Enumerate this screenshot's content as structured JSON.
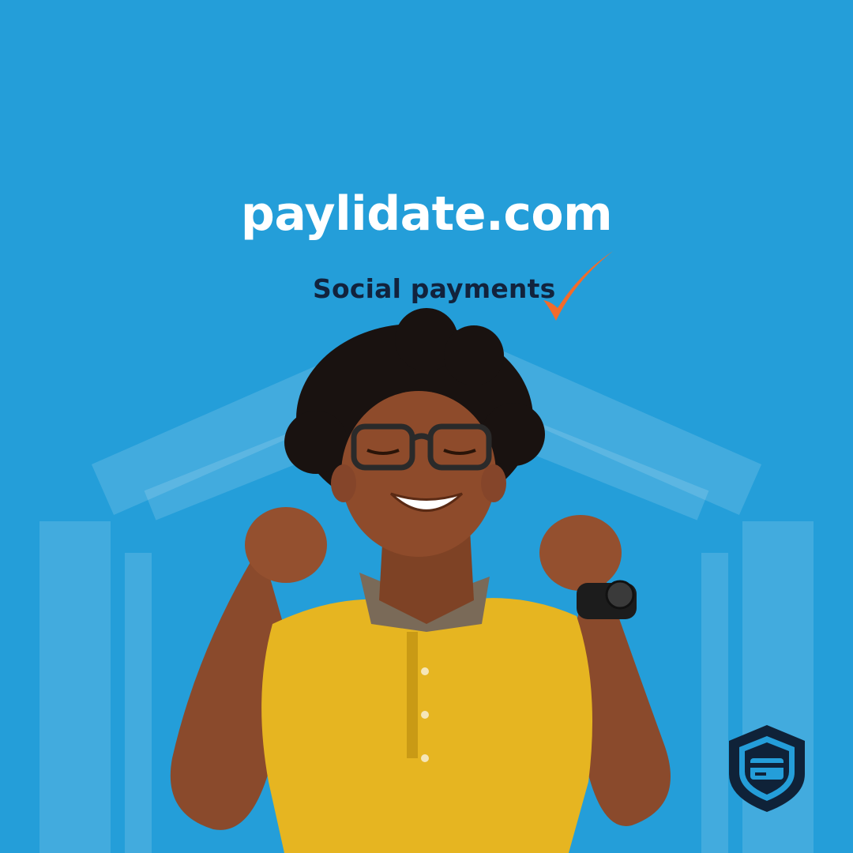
{
  "brand": {
    "domain": "paylidate.com",
    "tagline": "Social payments"
  },
  "icons": {
    "check": "checkmark-icon",
    "logo": "shield-card-logo-icon",
    "background": "shield-watermark-icon"
  },
  "colors": {
    "background": "#249ed9",
    "headline": "#ffffff",
    "tagline": "#12233d",
    "check": "#f26b2a",
    "logo": "#0f2238",
    "shirt": "#e6b521"
  }
}
